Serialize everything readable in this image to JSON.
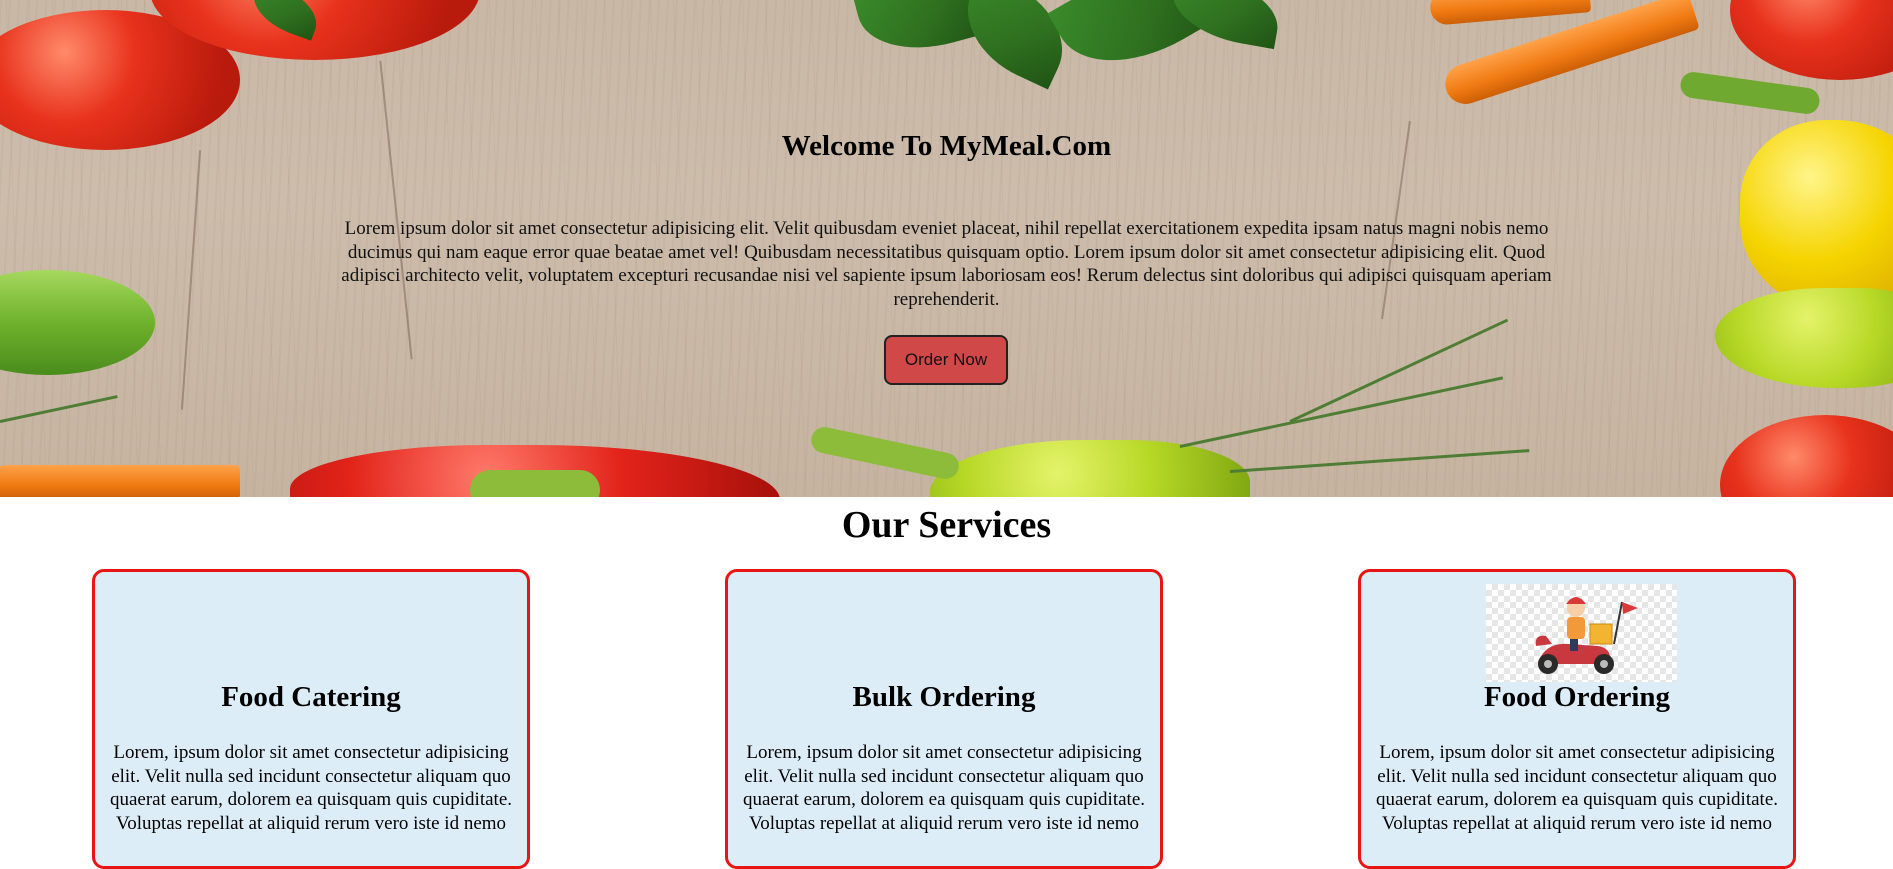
{
  "hero": {
    "title": "Welcome To MyMeal.Com",
    "text": "Lorem ipsum dolor sit amet consectetur adipisicing elit. Velit quibusdam eveniet placeat, nihil repellat exercitationem expedita ipsam natus magni nobis nemo ducimus qui nam eaque error quae beatae amet vel! Quibusdam necessitatibus quisquam optio. Lorem ipsum dolor sit amet consectetur adipisicing elit. Quod adipisci architecto velit, voluptatem excepturi recusandae nisi vel sapiente ipsum laboriosam eos! Rerum delectus sint doloribus qui adipisci quisquam aperiam reprehenderit.",
    "button_label": "Order Now",
    "button_color": "#d04848"
  },
  "services": {
    "title": "Our Services",
    "border_color": "#e81515",
    "card_bg": "#ddedf8",
    "cards": [
      {
        "title": "Food Catering",
        "text": "Lorem, ipsum dolor sit amet consectetur adipisicing elit. Velit nulla sed incidunt consectetur aliquam quo quaerat earum, dolorem ea quisquam quis cupiditate. Voluptas repellat at aliquid rerum vero iste id nemo"
      },
      {
        "title": "Bulk Ordering",
        "text": "Lorem, ipsum dolor sit amet consectetur adipisicing elit. Velit nulla sed incidunt consectetur aliquam quo quaerat earum, dolorem ea quisquam quis cupiditate. Voluptas repellat at aliquid rerum vero iste id nemo"
      },
      {
        "title": "Food Ordering",
        "text": "Lorem, ipsum dolor sit amet consectetur adipisicing elit. Velit nulla sed incidunt consectetur aliquam quo quaerat earum, dolorem ea quisquam quis cupiditate. Voluptas repellat at aliquid rerum vero iste id nemo",
        "image_icon": "delivery-scooter-icon"
      }
    ]
  }
}
